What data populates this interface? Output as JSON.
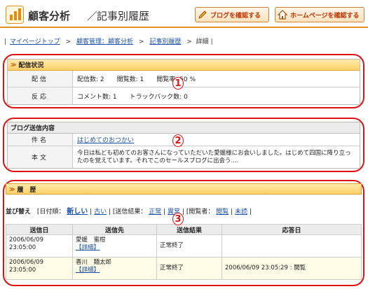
{
  "header": {
    "section_title": "顧客分析",
    "separator": "／",
    "page_title": "記事別履歴",
    "blog_button": "ブログを確認する",
    "home_button": "ホームページを確認する"
  },
  "breadcrumb": {
    "items": [
      "マイページトップ",
      "顧客管理：顧客分析",
      "記事別履歴"
    ],
    "current": "詳細",
    "sep": ">"
  },
  "delivery": {
    "title": "配信状況",
    "rows": [
      {
        "label": "配信",
        "value": "配信数: 2　　閲覧数: 1　　閲覧率: 50 %"
      },
      {
        "label": "反応",
        "value": "コメント数: 1　　トラックバック数: 0"
      }
    ],
    "marker": "1"
  },
  "blog": {
    "title": "ブログ送信内容",
    "subject_label": "件名",
    "subject_value": "はじめてのおつかい",
    "body_label": "本文",
    "body_value": "今日は私ども初めてのお客さんになっていただいた愛媛様にお会いしました。はじめて四国に降り立ったのを覚えています。それでこのセールスブログに出会う....",
    "marker": "2"
  },
  "history": {
    "title": "履　歴",
    "sort_label": "並び替え",
    "date_order_label": "[日付順：",
    "newest": "新しい",
    "oldest": "古い",
    "result_label": "| [送信結果：",
    "normal": "正常",
    "error": "異常",
    "viewer_label": "| [閲覧者：",
    "viewed": "閲覧",
    "unread": "未読",
    "marker": "3",
    "columns": [
      "送信日",
      "送信先",
      "送信結果",
      "応答日"
    ],
    "rows": [
      {
        "date": "2006/06/09",
        "time": "23:05:00",
        "recipient": "愛媛　蜜柑",
        "detail": "【詳細】",
        "result": "正常終了",
        "response": ""
      },
      {
        "date": "2006/06/09",
        "time": "23:05:00",
        "recipient": "香川　麺太郎",
        "detail": "【詳細】",
        "result": "正常終了",
        "response": "2006/06/09 23:05:29 : 閲覧"
      }
    ]
  },
  "colors": {
    "accent": "#e09020",
    "annotation": "#e01010",
    "link": "#1a4fa8"
  }
}
